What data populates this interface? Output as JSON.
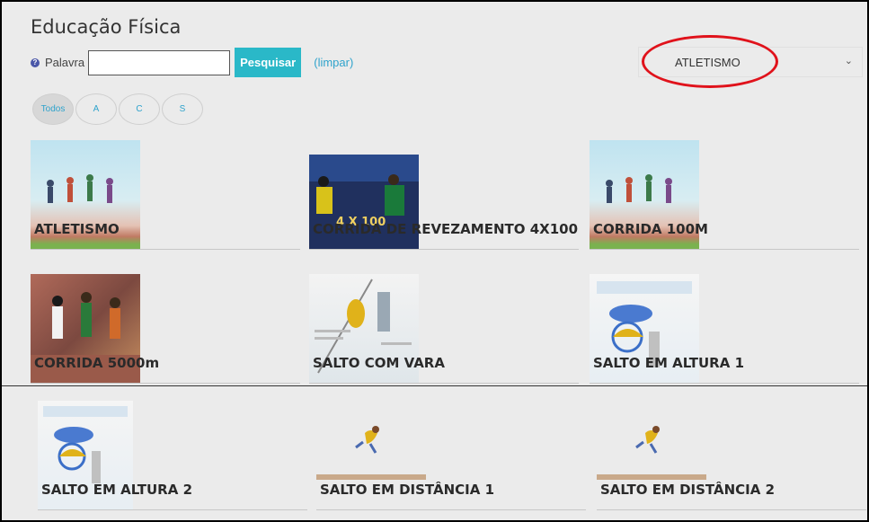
{
  "page": {
    "title": "Educação Física"
  },
  "search": {
    "label": "Palavra",
    "value": "",
    "placeholder": "",
    "button": "Pesquisar",
    "clear": "(limpar)"
  },
  "category": {
    "selected": "ATLETISMO"
  },
  "filters": [
    {
      "label": "Todos"
    },
    {
      "label": "A"
    },
    {
      "label": "C"
    },
    {
      "label": "S"
    }
  ],
  "items": [
    {
      "label": "ATLETISMO"
    },
    {
      "label": "CORRIDA DE REVEZAMENTO 4X100",
      "thumb_text": "4 X 100"
    },
    {
      "label": "CORRIDA 100M"
    },
    {
      "label": "CORRIDA 5000m"
    },
    {
      "label": "SALTO COM VARA"
    },
    {
      "label": "SALTO EM ALTURA 1"
    },
    {
      "label": "SALTO EM ALTURA 2"
    },
    {
      "label": "SALTO EM DISTÂNCIA 1"
    },
    {
      "label": "SALTO EM DISTÂNCIA 2"
    }
  ],
  "colors": {
    "accent": "#2ab8c8",
    "link": "#2fa3cc",
    "highlight": "#e0121b"
  }
}
